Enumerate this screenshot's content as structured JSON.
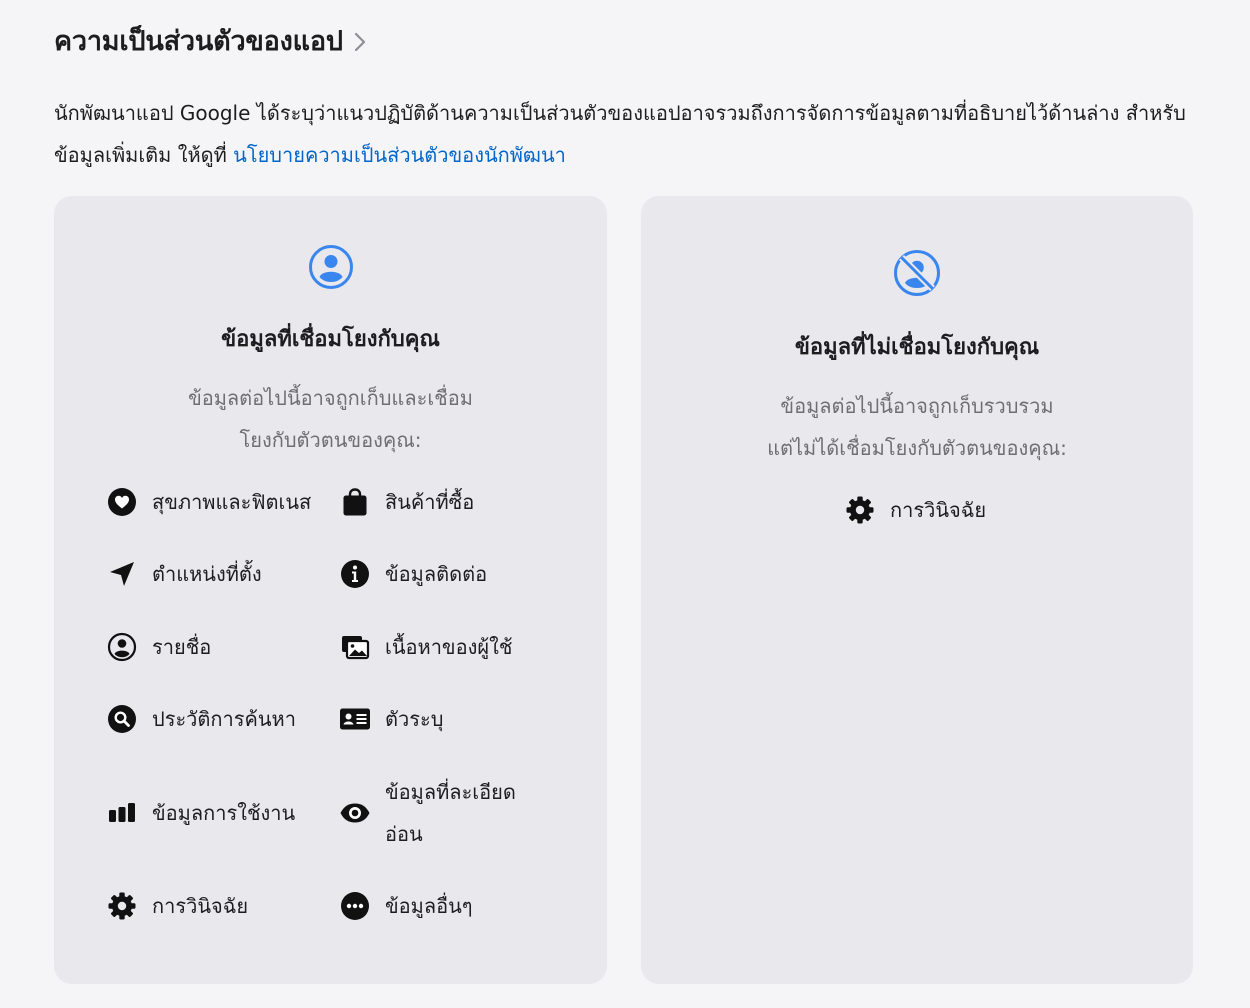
{
  "header": {
    "title": "ความเป็นส่วนตัวของแอป"
  },
  "description": {
    "text": "นักพัฒนาแอป Google ได้ระบุว่าแนวปฏิบัติด้านความเป็นส่วนตัวของแอปอาจรวมถึงการจัดการข้อมูลตามที่อธิบายไว้ด้านล่าง สำหรับข้อมูลเพิ่มเติม ให้ดูที่ ",
    "link": "นโยบายความเป็นส่วนตัวของนักพัฒนา"
  },
  "linked_card": {
    "icon": "person-circle-icon",
    "title": "ข้อมูลที่เชื่อมโยงกับคุณ",
    "subtitle_line1": "ข้อมูลต่อไปนี้อาจถูกเก็บและเชื่อม",
    "subtitle_line2": "โยงกับตัวตนของคุณ:",
    "items": [
      {
        "icon": "heart-icon",
        "label": "สุขภาพและฟิตเนส"
      },
      {
        "icon": "shopping-bag-icon",
        "label": "สินค้าที่ซื้อ"
      },
      {
        "icon": "location-arrow-icon",
        "label": "ตำแหน่งที่ตั้ง"
      },
      {
        "icon": "info-icon",
        "label": "ข้อมูลติดต่อ"
      },
      {
        "icon": "person-circle-icon",
        "label": "รายชื่อ"
      },
      {
        "icon": "photos-icon",
        "label": "เนื้อหาของผู้ใช้"
      },
      {
        "icon": "search-icon",
        "label": "ประวัติการค้นหา"
      },
      {
        "icon": "id-card-icon",
        "label": "ตัวระบุ"
      },
      {
        "icon": "bar-chart-icon",
        "label": "ข้อมูลการใช้งาน"
      },
      {
        "icon": "eye-icon",
        "label": "ข้อมูลที่ละเอียดอ่อน"
      },
      {
        "icon": "gear-icon",
        "label": "การวินิจฉัย"
      },
      {
        "icon": "more-icon",
        "label": "ข้อมูลอื่นๆ"
      }
    ]
  },
  "unlinked_card": {
    "icon": "person-slash-icon",
    "title": "ข้อมูลที่ไม่เชื่อมโยงกับคุณ",
    "subtitle_line1": "ข้อมูลต่อไปนี้อาจถูกเก็บรวบรวม",
    "subtitle_line2": "แต่ไม่ได้เชื่อมโยงกับตัวตนของคุณ:",
    "items": [
      {
        "icon": "gear-icon",
        "label": "การวินิจฉัย"
      }
    ]
  },
  "colors": {
    "accent": "#0066cc",
    "icon_blue": "#3a86ef",
    "card_bg": "#e8e8ed",
    "page_bg": "#f5f5f7",
    "muted_text": "#6e6e73"
  }
}
